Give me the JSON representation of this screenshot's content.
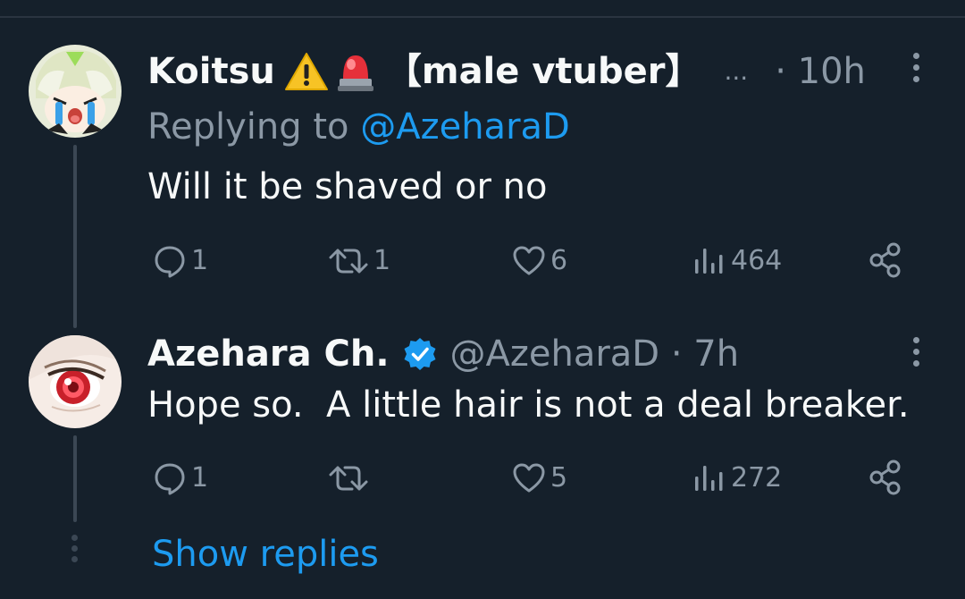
{
  "tweets": [
    {
      "display_name": "Koitsu",
      "emoji_icons": [
        "warning-icon",
        "siren-icon"
      ],
      "name_suffix": "【male vtuber】",
      "ellipsis": "...",
      "time": "· 10h",
      "replying_prefix": "Replying to ",
      "replying_handle": "@AzeharaD",
      "text": "Will it be shaved or no",
      "stats": {
        "replies": "1",
        "reposts": "1",
        "likes": "6",
        "views": "464"
      }
    },
    {
      "display_name": "Azehara Ch.",
      "verified": true,
      "handle_time": "@AzeharaD · 7h",
      "text": "Hope so.  A little hair is not a deal breaker.",
      "stats": {
        "replies": "1",
        "likes": "5",
        "views": "272"
      }
    }
  ],
  "show_replies": "Show replies",
  "colors": {
    "background": "#15202b",
    "text": "#f7f9f9",
    "muted": "#8b98a5",
    "accent": "#1d9bf0",
    "thread_line": "#3b4754"
  }
}
